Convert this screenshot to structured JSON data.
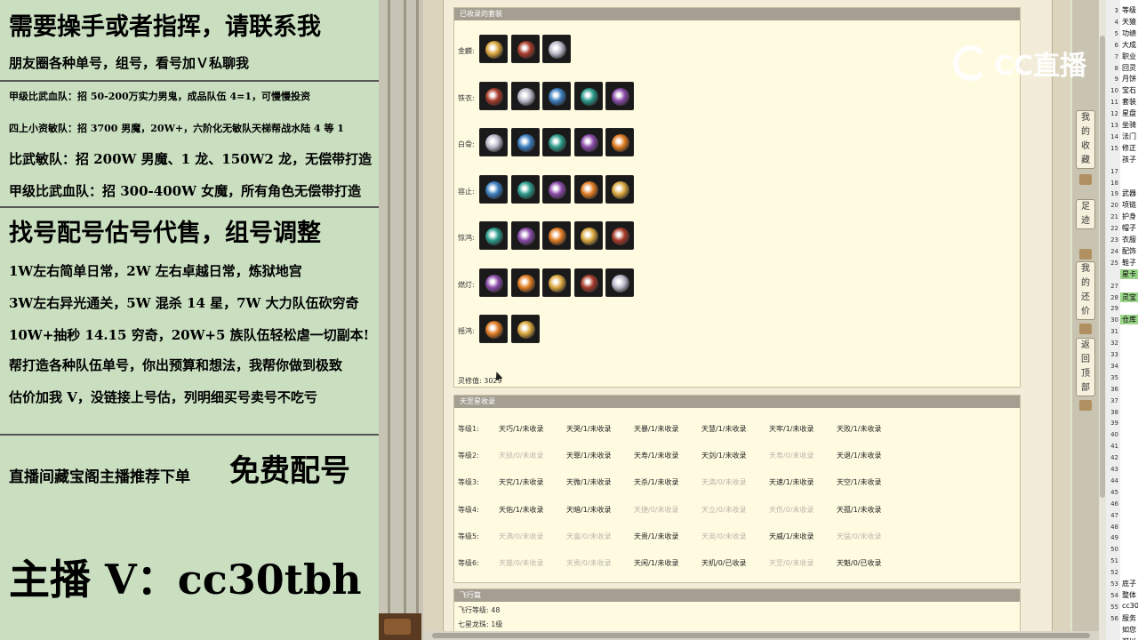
{
  "overlay": {
    "lines": [
      "需要操手或者指挥，请联系我",
      "朋友圈各种单号，组号，看号加Ｖ私聊我",
      "甲级比武血队：招 50-200万实力男鬼，成品队伍 4=1，可慢慢投资",
      "四上小资敏队：招 3700 男魔，20W+，六阶化无敏队天梯帮战水陆 4 等 1",
      "比武敏队：招 200W 男魔、1 龙、150W2 龙，无偿带打造",
      "甲级比武血队：招 300-400W 女魔，所有角色无偿带打造",
      "找号配号估号代售，组号调整",
      "1W左右简单日常，2W 左右卓越日常，炼狱地宫",
      "3W左右异光通关，5W 混杀 14 星，7W 大力队伍砍穷奇",
      "10W+抽秒 14.15 穷奇，20W+5 族队伍轻松虐一切副本!",
      "帮打造各种队伍单号，你出预算和想法，我帮你做到极致",
      "估价加我 V，没链接上号估，列明细买号卖号不吃亏",
      "直播间藏宝阁主播推荐下单",
      "免费配号",
      "主播 V：cc30tbh"
    ]
  },
  "collection": {
    "header": "已收录的套装",
    "rows": [
      {
        "label": "金麟:",
        "icons": [
          "ring-icon",
          "ring-icon",
          "amulet-icon"
        ]
      },
      {
        "label": "铁衣:",
        "icons": [
          "ring-icon",
          "ring-icon",
          "ring-icon",
          "amulet-icon",
          "ring-icon"
        ]
      },
      {
        "label": "白骨:",
        "icons": [
          "bracelet-icon",
          "weapon-icon",
          "mask-icon",
          "ring-icon",
          "ring-icon"
        ]
      },
      {
        "label": "容止:",
        "icons": [
          "armor-icon",
          "weapon-icon",
          "belt-icon",
          "helm-icon",
          "boots-icon"
        ]
      },
      {
        "label": "惊鸿:",
        "icons": [
          "armor-icon",
          "helm-icon",
          "bracelet-icon",
          "whip-icon",
          "mask-icon"
        ]
      },
      {
        "label": "燃灯:",
        "icons": [
          "flame-icon",
          "robe-icon",
          "mask-icon",
          "shield-icon",
          "gem-icon"
        ]
      },
      {
        "label": "摇鸿:",
        "icons": [
          "robe-icon",
          "amulet-icon"
        ]
      }
    ],
    "score_label": "灵修值: 3029",
    "colors": {
      "gold": "#d9a53c",
      "red": "#a83a2a",
      "silver": "#b9b9c9",
      "blue": "#3a7dbf",
      "teal": "#2a9a8a",
      "purple": "#8a4aa8",
      "orange": "#e07a20"
    }
  },
  "tiangang": {
    "header": "天罡星收录",
    "levels": [
      {
        "label": "等级1:",
        "items": [
          {
            "t": "天巧/1/未收录",
            "on": true
          },
          {
            "t": "天哭/1/未收录",
            "on": true
          },
          {
            "t": "天暴/1/未收录",
            "on": true
          },
          {
            "t": "天慧/1/未收录",
            "on": true
          },
          {
            "t": "天牢/1/未收录",
            "on": true
          },
          {
            "t": "天败/1/未收录",
            "on": true
          }
        ]
      },
      {
        "label": "等级2:",
        "items": [
          {
            "t": "天损/0/未收录",
            "on": false
          },
          {
            "t": "天罪/1/未收录",
            "on": true
          },
          {
            "t": "天寿/1/未收录",
            "on": true
          },
          {
            "t": "天剑/1/未收录",
            "on": true
          },
          {
            "t": "天寿/0/未收录",
            "on": false
          },
          {
            "t": "天退/1/未收录",
            "on": true
          }
        ]
      },
      {
        "label": "等级3:",
        "items": [
          {
            "t": "天究/1/未收录",
            "on": true
          },
          {
            "t": "天微/1/未收录",
            "on": true
          },
          {
            "t": "天杀/1/未收录",
            "on": true
          },
          {
            "t": "天満/0/未收录",
            "on": false
          },
          {
            "t": "天速/1/未收录",
            "on": true
          },
          {
            "t": "天空/1/未收录",
            "on": true
          }
        ]
      },
      {
        "label": "等级4:",
        "items": [
          {
            "t": "天佑/1/未收录",
            "on": true
          },
          {
            "t": "天暗/1/未收录",
            "on": true
          },
          {
            "t": "天捷/0/未收录",
            "on": false
          },
          {
            "t": "天立/0/未收录",
            "on": false
          },
          {
            "t": "天伤/0/未收录",
            "on": false
          },
          {
            "t": "天孤/1/未收录",
            "on": true
          }
        ]
      },
      {
        "label": "等级5:",
        "items": [
          {
            "t": "天满/0/未收录",
            "on": false
          },
          {
            "t": "天富/0/未收录",
            "on": false
          },
          {
            "t": "天贵/1/未收录",
            "on": true
          },
          {
            "t": "天英/0/未收录",
            "on": false
          },
          {
            "t": "天威/1/未收录",
            "on": true
          },
          {
            "t": "天猛/0/未收录",
            "on": false
          }
        ]
      },
      {
        "label": "等级6:",
        "items": [
          {
            "t": "天雄/0/未收录",
            "on": false
          },
          {
            "t": "天贵/0/未收录",
            "on": false
          },
          {
            "t": "天闲/1/未收录",
            "on": true
          },
          {
            "t": "天机/0/已收录",
            "on": true
          },
          {
            "t": "天罡/0/未收录",
            "on": false
          },
          {
            "t": "天魁/0/已收录",
            "on": true
          }
        ]
      }
    ]
  },
  "flight": {
    "header": "飞行篇",
    "level": "飞行等级: 48",
    "dragon": "七星龙珠: 1级"
  },
  "sidetabs": [
    {
      "name": "my-collection",
      "chars": [
        "我",
        "的",
        "收",
        "藏"
      ]
    },
    {
      "name": "footprint",
      "chars": [
        "足",
        "迹"
      ]
    },
    {
      "name": "my-bargain",
      "chars": [
        "我",
        "的",
        "还",
        "价"
      ]
    },
    {
      "name": "back-to-top",
      "chars": [
        "返",
        "回",
        "顶",
        "部"
      ]
    }
  ],
  "watermark": "CC直播",
  "sheet": {
    "rows": [
      "3",
      "4",
      "5",
      "6",
      "7",
      "8",
      "9",
      "10",
      "11",
      "12",
      "13",
      "14",
      "15",
      "",
      "17",
      "18",
      "19",
      "20",
      "21",
      "22",
      "23",
      "24",
      "25",
      "",
      "27",
      "28",
      "29",
      "30",
      "31",
      "32",
      "33",
      "34",
      "35",
      "36",
      "37",
      "38",
      "39",
      "40",
      "41",
      "42",
      "43",
      "44",
      "45",
      "46",
      "47",
      "48",
      "49",
      "50",
      "51",
      "52",
      "53",
      "54",
      "55",
      "56"
    ],
    "cells": [
      {
        "r": 0,
        "t": "等级"
      },
      {
        "r": 1,
        "t": "天猿"
      },
      {
        "r": 2,
        "t": "功绩"
      },
      {
        "r": 3,
        "t": "大成"
      },
      {
        "r": 4,
        "t": "职业"
      },
      {
        "r": 5,
        "t": "回灵"
      },
      {
        "r": 6,
        "t": "月饼"
      },
      {
        "r": 7,
        "t": "宝石"
      },
      {
        "r": 8,
        "t": "套装"
      },
      {
        "r": 9,
        "t": "星盘"
      },
      {
        "r": 10,
        "t": "坐骑"
      },
      {
        "r": 11,
        "t": "法门"
      },
      {
        "r": 12,
        "t": "修正"
      },
      {
        "r": 13,
        "t": "孩子"
      },
      {
        "r": 16,
        "t": "武器"
      },
      {
        "r": 17,
        "t": "项链"
      },
      {
        "r": 18,
        "t": "护身"
      },
      {
        "r": 19,
        "t": "帽子"
      },
      {
        "r": 20,
        "t": "衣服"
      },
      {
        "r": 21,
        "t": "配饰"
      },
      {
        "r": 22,
        "t": "鞋子"
      },
      {
        "r": 23,
        "t": "星卡",
        "hl": true
      },
      {
        "r": 25,
        "t": "灵宝",
        "hl": true
      },
      {
        "r": 27,
        "t": "仓库",
        "hl": true
      },
      {
        "r": 50,
        "t": "底子"
      },
      {
        "r": 51,
        "t": "整体"
      },
      {
        "r": 52,
        "t": "cc30"
      },
      {
        "r": 53,
        "t": "服务"
      },
      {
        "r": 54,
        "t": "如您"
      },
      {
        "r": 55,
        "t": "可以"
      }
    ]
  }
}
